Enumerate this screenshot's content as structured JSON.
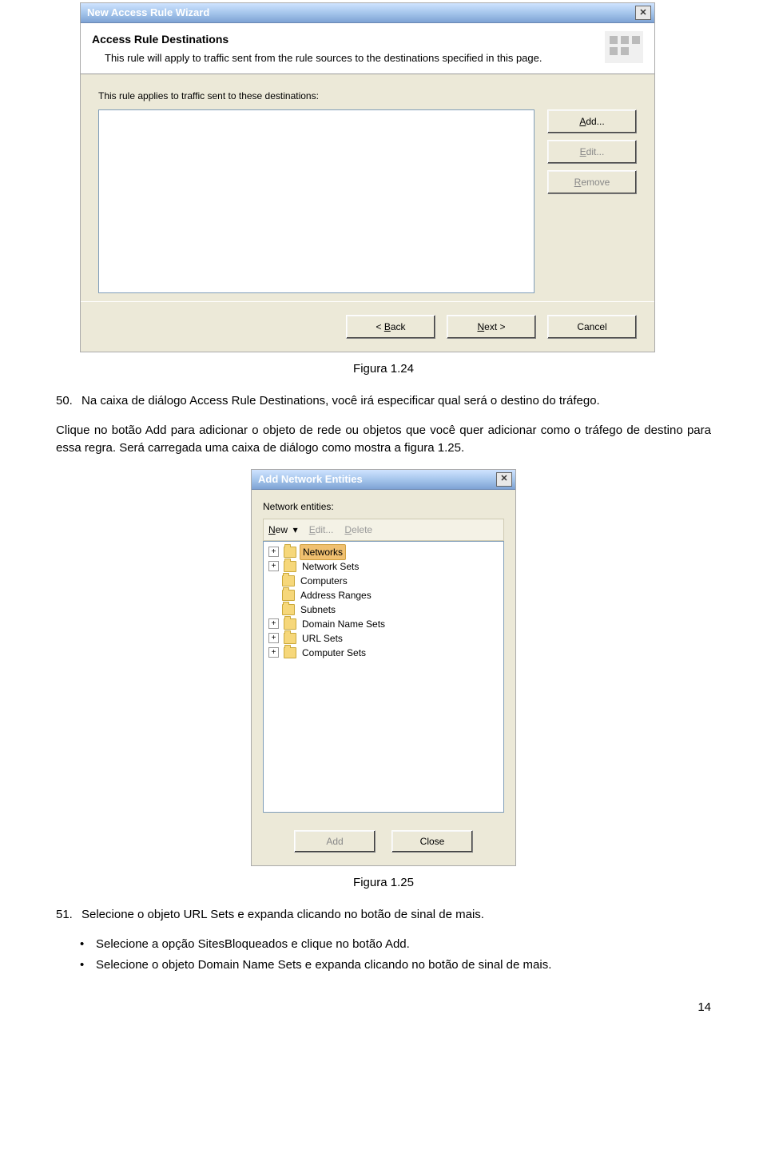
{
  "dialog1": {
    "title": "New Access Rule Wizard",
    "header_title": "Access Rule Destinations",
    "header_desc": "This rule will apply to traffic sent from the rule sources to the destinations specified in this page.",
    "body_label": "This rule applies to traffic sent to these destinations:",
    "buttons": {
      "add": "Add...",
      "edit": "Edit...",
      "remove": "Remove",
      "back": "< Back",
      "next": "Next >",
      "cancel": "Cancel"
    }
  },
  "caption1": "Figura 1.24",
  "para50": {
    "num": "50.",
    "sentence1": "Na caixa de diálogo Access Rule Destinations, você irá especificar qual será o destino do tráfego.",
    "sentence2": "Clique no botão Add para adicionar o objeto de rede ou objetos que você quer adicionar como o tráfego de destino para essa regra. Será carregada uma caixa de diálogo como mostra a figura 1.25."
  },
  "dialog2": {
    "title": "Add Network Entities",
    "label": "Network entities:",
    "toolbar": {
      "new": "New",
      "edit": "Edit...",
      "delete": "Delete"
    },
    "tree": [
      {
        "expand": "+",
        "label": "Networks",
        "selected": true
      },
      {
        "expand": "+",
        "label": "Network Sets"
      },
      {
        "expand": "",
        "label": "Computers"
      },
      {
        "expand": "",
        "label": "Address Ranges"
      },
      {
        "expand": "",
        "label": "Subnets"
      },
      {
        "expand": "+",
        "label": "Domain Name Sets"
      },
      {
        "expand": "+",
        "label": "URL Sets"
      },
      {
        "expand": "+",
        "label": "Computer Sets"
      }
    ],
    "buttons": {
      "add": "Add",
      "close": "Close"
    }
  },
  "caption2": "Figura 1.25",
  "para51": {
    "num": "51.",
    "text": "Selecione o objeto URL Sets e expanda clicando no botão de sinal de mais."
  },
  "bullets": [
    "Selecione a opção SitesBloqueados e clique no botão Add.",
    "Selecione o objeto Domain Name Sets e expanda clicando no botão de sinal de mais."
  ],
  "page_number": "14"
}
